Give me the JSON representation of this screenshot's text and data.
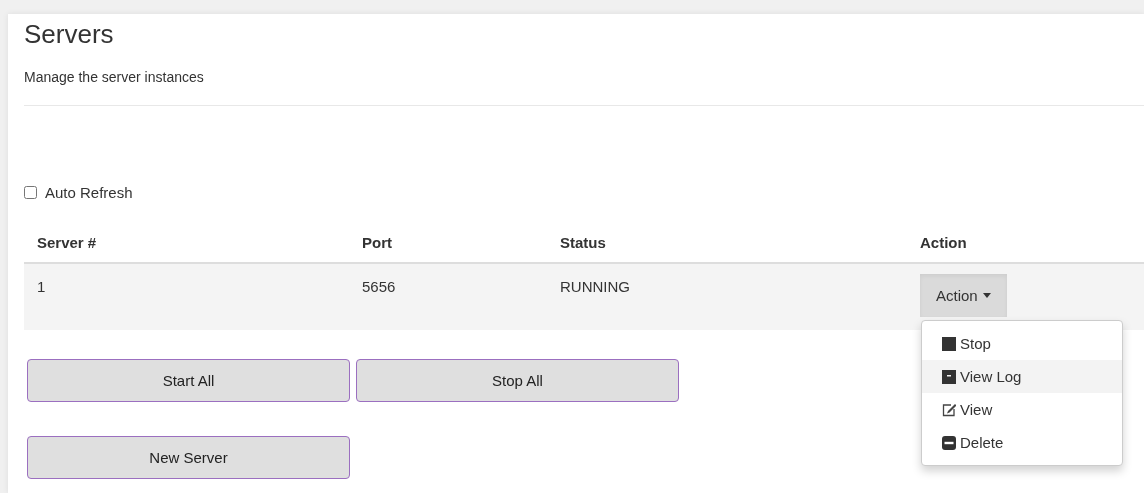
{
  "page": {
    "title": "Servers",
    "subtitle": "Manage the server instances"
  },
  "auto_refresh": {
    "label": "Auto Refresh",
    "checked": false
  },
  "table": {
    "columns": [
      "Server #",
      "Port",
      "Status",
      "Action"
    ],
    "rows": [
      {
        "cells": [
          "1",
          "5656",
          "RUNNING"
        ],
        "action": "Action",
        "expanded": true
      }
    ]
  },
  "action_menu": [
    {
      "kind": "stop",
      "label": "Stop",
      "selected": false
    },
    {
      "kind": "log",
      "label": "View Log",
      "selected": true
    },
    {
      "kind": "edit",
      "label": "View",
      "selected": false
    },
    {
      "kind": "delete",
      "label": "Delete",
      "selected": false
    }
  ],
  "buttons": [
    [
      "Start All",
      "Stop All"
    ],
    [
      "New Server"
    ]
  ]
}
